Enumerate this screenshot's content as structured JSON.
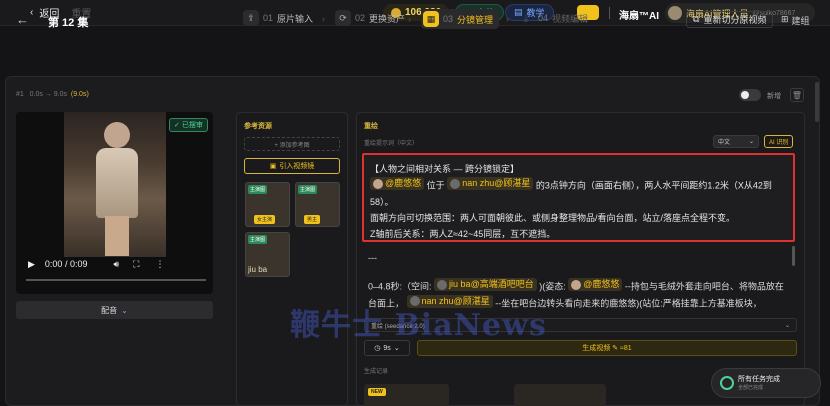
{
  "topbar": {
    "back_label": "返回",
    "faded_label": "重置",
    "coins": "106,980",
    "recharge": "充值",
    "tutorial": "教学",
    "brand": "海扇™AI",
    "user_name": "海扇AI管理人员",
    "user_email": "@sulko7866727..."
  },
  "header": {
    "episode": "第 12 集",
    "steps": [
      {
        "num": "01",
        "label": "原片输入"
      },
      {
        "num": "02",
        "label": "更换资产"
      },
      {
        "num": "03",
        "label": "分镜管理"
      },
      {
        "num": "04",
        "label": "视频编辑"
      }
    ],
    "resplit": "重新切分原视频",
    "build": "建组"
  },
  "shot": {
    "index": "#1",
    "range": "0.0s → 9.0s",
    "duration": "(9.0s)",
    "toggle_label": "新增"
  },
  "video": {
    "done_tag": "已摆审",
    "time": "0:00 / 0:09",
    "dub_label": "配音"
  },
  "refs": {
    "title": "参考资源",
    "add": "+ 添加参考图",
    "import": "引入视频镜",
    "thumbs": [
      {
        "badge": "主演图",
        "role": "女主演"
      },
      {
        "badge": "主演图",
        "role": "男主"
      },
      {
        "badge": "主演图",
        "caption": "jiu ba"
      }
    ]
  },
  "main": {
    "title": "重绘",
    "subtitle": "重绘提示词（中文）",
    "lang": "中文",
    "ai_btn": "AI 识别",
    "box": {
      "line1": "【人物之间相对关系 — 跨分镜锁定】",
      "chip_a": "@鹿悠悠",
      "mid1": "位于",
      "chip_b": "nan zhu@顾湛星",
      "tail1": "的3点钟方向（画面右侧），两人水平间距约1.2米（X从42到58）。",
      "line3": "面朝方向可切换范围：两人可面朝彼此、或侧身整理物品/看向台面，站立/落座点全程不变。",
      "line4": "Z轴前后关系：两人Z≈42~45同层，互不遮挡。"
    },
    "sep": "---",
    "p_a": "0–4.8秒:（空间:",
    "chip_c": "jiu  ba@高端酒吧吧台",
    "p_b": ")(姿态:",
    "chip_d": "@鹿悠悠",
    "p_c": "--持包与毛绒外套走向吧台、将物品放在台面上，",
    "chip_e": "nan zhu@顾湛星",
    "p_d": "--坐在吧台边转头看向走来的鹿悠悠)(站位:严格挂靠上方基准板块，",
    "model": "重绘 (seedance 2.0)",
    "duration": "9s",
    "generate": "生成视频 ✎ ≈81",
    "history": "生成记录",
    "new_badge": "NEW"
  },
  "toast": {
    "title": "所有任务完成",
    "sub": "全部已完成"
  },
  "watermark": "鞭牛士 BiaNews"
}
